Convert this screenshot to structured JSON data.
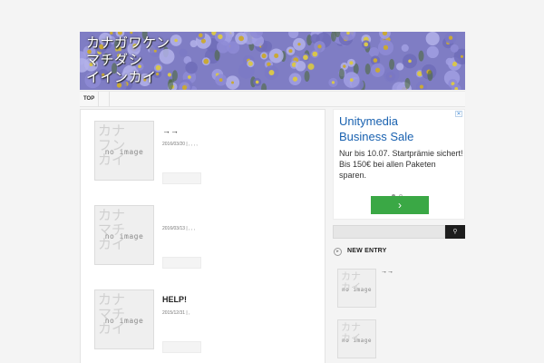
{
  "header": {
    "title_lines": [
      "カナガワケン",
      "マチダシ",
      "イインカイ"
    ]
  },
  "nav": {
    "items": [
      {
        "label": "TOP"
      }
    ]
  },
  "posts": [
    {
      "title": "→→",
      "meta": "2016/03/20 | , , , ,",
      "thumb_kana": [
        "カナ",
        "フン",
        "カイ"
      ],
      "thumb_label": "no image"
    },
    {
      "title": "",
      "meta": "2016/03/13 | , , ,",
      "thumb_kana": [
        "カナ",
        "マチ",
        "カイ"
      ],
      "thumb_label": "no image"
    },
    {
      "title": "HELP!",
      "meta": "2015/12/31 | ,",
      "thumb_kana": [
        "カナ",
        "マチ",
        "カイ"
      ],
      "thumb_label": "no image"
    }
  ],
  "ad": {
    "close_icon": "close-icon",
    "headline_lines": [
      "Unitymedia",
      "Business Sale"
    ],
    "body": "Nur bis 10.07. Startprämie sichert! Bis 150€ bei allen Paketen sparen.",
    "cta_icon": "chevron-right-icon",
    "cta_glyph": "›",
    "dots_active": 0,
    "dots_count": 2,
    "cta_color": "#3aa845",
    "headline_color": "#1a62b0"
  },
  "search": {
    "placeholder": "",
    "button_icon": "search-icon",
    "button_glyph": "⚲"
  },
  "new_entry": {
    "title": "NEW ENTRY",
    "icon": "circle-arrow-icon",
    "items": [
      {
        "title": "→→",
        "thumb_kana": [
          "カナ",
          "",
          "カイ"
        ],
        "thumb_label": "no image"
      },
      {
        "title": "",
        "thumb_kana": [
          "カナ",
          "",
          "カイ"
        ],
        "thumb_label": "no image"
      }
    ]
  },
  "colors": {
    "banner": "#7f7dc4",
    "background": "#f4f4f4"
  }
}
